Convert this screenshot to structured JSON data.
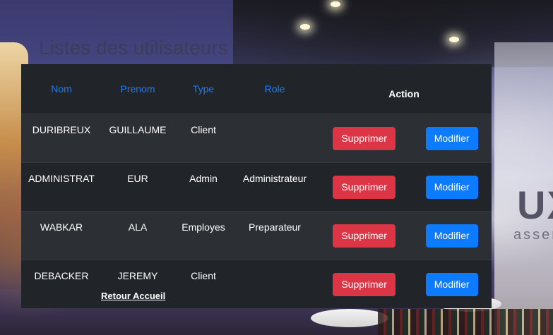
{
  "page": {
    "title": "Listes des utilisateurs"
  },
  "table": {
    "headers": {
      "nom": "Nom",
      "prenom": "Prenom",
      "type": "Type",
      "role": "Role",
      "action": "Action"
    },
    "rows": [
      {
        "nom": "DURIBREUX",
        "prenom": "GUILLAUME",
        "type": "Client",
        "role": ""
      },
      {
        "nom": "ADMINISTRAT",
        "prenom": "EUR",
        "type": "Admin",
        "role": "Administrateur"
      },
      {
        "nom": "WABKAR",
        "prenom": "ALA",
        "type": "Employes",
        "role": "Preparateur"
      },
      {
        "nom": "DEBACKER",
        "prenom": "JEREMY",
        "type": "Client",
        "role": ""
      }
    ],
    "delete_label": "Supprimer",
    "edit_label": "Modifier"
  },
  "footer": {
    "back_link": "Retour Accueil"
  },
  "colors": {
    "table_bg": "#212529",
    "header_link": "#1e7bf2",
    "delete": "#dc3545",
    "edit": "#0d7bff"
  },
  "background": {
    "brand_text": "UX",
    "brand_subtext": "asserie"
  }
}
